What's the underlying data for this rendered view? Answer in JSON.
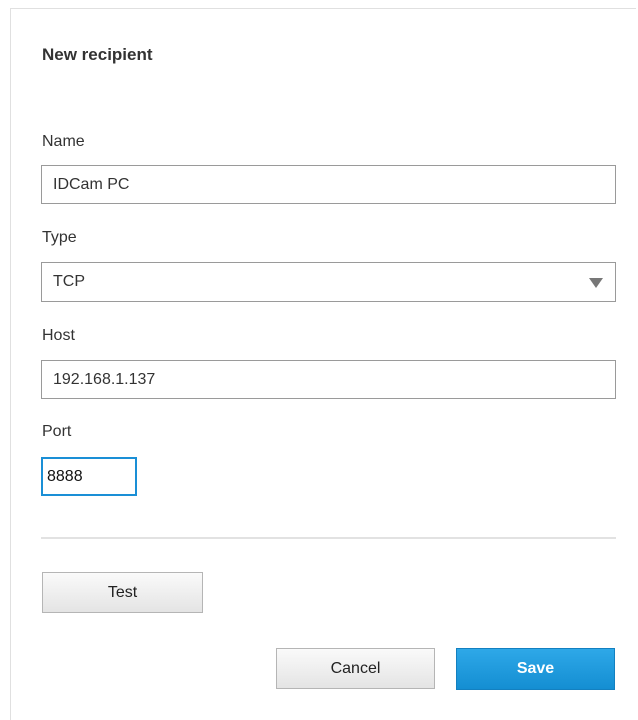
{
  "dialog": {
    "title": "New recipient"
  },
  "form": {
    "name": {
      "label": "Name",
      "value": "IDCam PC"
    },
    "type": {
      "label": "Type",
      "value": "TCP"
    },
    "host": {
      "label": "Host",
      "value": "192.168.1.137"
    },
    "port": {
      "label": "Port",
      "value": "8888"
    }
  },
  "buttons": {
    "test": "Test",
    "cancel": "Cancel",
    "save": "Save"
  },
  "colors": {
    "accent": "#1a8fd6",
    "save_button": "#1d98dc"
  }
}
